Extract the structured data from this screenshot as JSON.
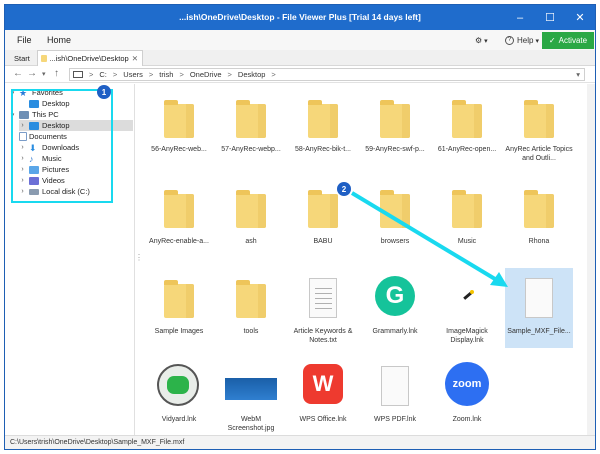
{
  "window": {
    "title": "...ish\\OneDrive\\Desktop - File Viewer Plus [Trial 14 days left]",
    "controls": {
      "minimize": "–",
      "maximize": "☐",
      "close": "✕"
    }
  },
  "menubar": {
    "file": "File",
    "home": "Home",
    "settings_icon": "⚙",
    "settings_caret": "▾",
    "help_icon": "?",
    "help_label": "Help",
    "help_caret": "▾",
    "activate_check": "✓",
    "activate_label": "Activate"
  },
  "tabs": {
    "start": "Start",
    "desktop": "...ish\\OneDrive\\Desktop",
    "close": "✕"
  },
  "address": {
    "back": "←",
    "forward": "→",
    "dropdown": "▾",
    "up": "↑",
    "segments": [
      "C:",
      "Users",
      "trish",
      "OneDrive",
      "Desktop"
    ],
    "sep": ">",
    "dd": "▾"
  },
  "sidebar": {
    "items": [
      {
        "label": "Favorites",
        "chev": "▾"
      },
      {
        "label": "Desktop",
        "chev": ""
      },
      {
        "label": "This PC",
        "chev": "▾"
      },
      {
        "label": "Desktop",
        "chev": "›"
      },
      {
        "label": "Documents",
        "chev": "›"
      },
      {
        "label": "Downloads",
        "chev": "›"
      },
      {
        "label": "Music",
        "chev": "›"
      },
      {
        "label": "Pictures",
        "chev": "›"
      },
      {
        "label": "Videos",
        "chev": "›"
      },
      {
        "label": "Local disk (C:)",
        "chev": "›"
      }
    ],
    "splitter": "⋮"
  },
  "files": [
    {
      "name": "56-AnyRec-web...",
      "type": "folder"
    },
    {
      "name": "57-AnyRec-webp...",
      "type": "folder"
    },
    {
      "name": "58-AnyRec-bik-t...",
      "type": "folder"
    },
    {
      "name": "59-AnyRec-swf-p...",
      "type": "folder"
    },
    {
      "name": "61-AnyRec-open...",
      "type": "folder"
    },
    {
      "name": "AnyRec Article Topics and Outli...",
      "type": "folder"
    },
    {
      "name": "AnyRec-enable-a...",
      "type": "folder"
    },
    {
      "name": "ash",
      "type": "folder"
    },
    {
      "name": "BABU",
      "type": "folder"
    },
    {
      "name": "browsers",
      "type": "folder"
    },
    {
      "name": "Music",
      "type": "folder"
    },
    {
      "name": "Rhona",
      "type": "folder"
    },
    {
      "name": "Sample Images",
      "type": "folder"
    },
    {
      "name": "tools",
      "type": "folder"
    },
    {
      "name": "Article Keywords & Notes.txt",
      "type": "text"
    },
    {
      "name": "Grammarly.lnk",
      "type": "grammarly"
    },
    {
      "name": "ImageMagick Display.lnk",
      "type": "imagemagick"
    },
    {
      "name": "Sample_MXF_File...",
      "type": "blank"
    },
    {
      "name": "Vidyard.lnk",
      "type": "vidyard"
    },
    {
      "name": "WebM Screenshot.jpg",
      "type": "jpg"
    },
    {
      "name": "WPS Office.lnk",
      "type": "wps"
    },
    {
      "name": "WPS PDF.lnk",
      "type": "blank"
    },
    {
      "name": "Zoom.lnk",
      "type": "zoom"
    }
  ],
  "annotations": {
    "badge1": "1",
    "badge2": "2",
    "color": "#19d9ef",
    "badge_color": "#1f5fc4"
  },
  "status": {
    "path": "C:\\Users\\trish\\OneDrive\\Desktop\\Sample_MXF_File.mxf"
  },
  "colors": {
    "titlebar": "#1f6ccc",
    "activate": "#2aa845",
    "selection": "#cde3f7"
  }
}
